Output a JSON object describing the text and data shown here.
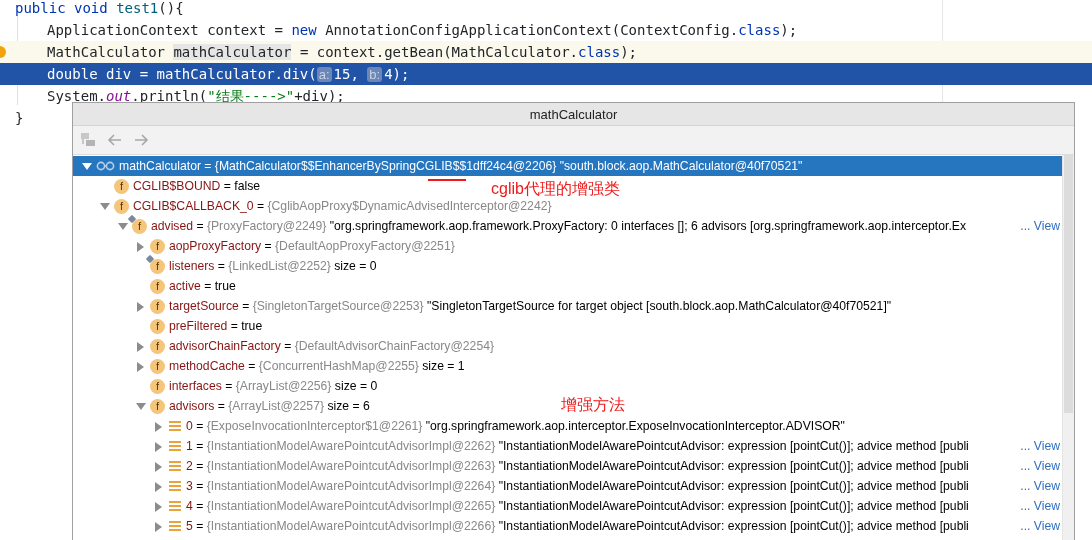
{
  "editor": {
    "lines": [
      {
        "caret": false,
        "current": false,
        "indented": false,
        "bulb": false,
        "tokens": [
          {
            "kind": "keyword",
            "text": "public void "
          },
          {
            "kind": "method",
            "text": "test1"
          },
          {
            "kind": "plain",
            "text": "(){"
          }
        ]
      },
      {
        "caret": false,
        "current": false,
        "indented": true,
        "bulb": false,
        "tokens": [
          {
            "kind": "plain",
            "text": "ApplicationContext context = "
          },
          {
            "kind": "keyword",
            "text": "new"
          },
          {
            "kind": "plain",
            "text": " AnnotationConfigApplicationContext(ContextConfig."
          },
          {
            "kind": "keyword",
            "text": "class"
          },
          {
            "kind": "plain",
            "text": ");"
          }
        ]
      },
      {
        "caret": true,
        "current": false,
        "indented": true,
        "bulb": true,
        "tokens": [
          {
            "kind": "plain",
            "text": "MathCalculator "
          },
          {
            "kind": "usage",
            "text": "mathCalculator"
          },
          {
            "kind": "plain",
            "text": " = context.getBean(MathCalculator."
          },
          {
            "kind": "keyword",
            "text": "class"
          },
          {
            "kind": "plain",
            "text": ");"
          }
        ]
      },
      {
        "caret": false,
        "current": true,
        "indented": true,
        "bulb": false,
        "tokens": [
          {
            "kind": "plain",
            "text": "double div = mathCalculator.div("
          },
          {
            "kind": "hint",
            "text": "a:"
          },
          {
            "kind": "plain",
            "text": "15, "
          },
          {
            "kind": "hint",
            "text": "b:"
          },
          {
            "kind": "plain",
            "text": "4);"
          }
        ]
      },
      {
        "caret": false,
        "current": false,
        "indented": true,
        "bulb": false,
        "tokens": [
          {
            "kind": "plain",
            "text": "System."
          },
          {
            "kind": "static",
            "text": "out"
          },
          {
            "kind": "plain",
            "text": ".println("
          },
          {
            "kind": "string",
            "text": "\"结果---->\""
          },
          {
            "kind": "plain",
            "text": "+div);"
          }
        ]
      },
      {
        "caret": false,
        "current": false,
        "indented": false,
        "bulb": false,
        "tokens": [
          {
            "kind": "plain",
            "text": "}"
          }
        ]
      }
    ]
  },
  "popup": {
    "title": "mathCalculator",
    "toolbar": [
      {
        "kind": "tree"
      },
      {
        "kind": "back"
      },
      {
        "kind": "forward"
      }
    ],
    "tree": [
      {
        "kind": "watch",
        "name": "mathCalculator",
        "eq": "=",
        "type": "{MathCalculator$$EnhancerBySpringCGLIB$$1dff24c4@2206}",
        "value": "\"south.block.aop.MathCalculator@40f70521\"",
        "selected": true,
        "expanded": true,
        "children": [
          {
            "kind": "field",
            "icon_letter": "f",
            "name": "CGLIB$BOUND",
            "eq": "=",
            "value": "false",
            "selected": false
          },
          {
            "kind": "field",
            "icon_letter": "f",
            "name": "CGLIB$CALLBACK_0",
            "eq": "=",
            "type": "{CglibAopProxy$DynamicAdvisedInterceptor@2242}",
            "selected": false,
            "expanded": true,
            "children": [
              {
                "kind": "tagged",
                "icon_letter": "f",
                "name": "advised",
                "eq": "=",
                "type": "{ProxyFactory@2249}",
                "value": "\"org.springframework.aop.framework.ProxyFactory: 0 interfaces []; 6 advisors [org.springframework.aop.interceptor.Ex",
                "link": "... View",
                "selected": false,
                "expanded": true,
                "children": [
                  {
                    "kind": "field",
                    "icon_letter": "f",
                    "name": "aopProxyFactory",
                    "eq": "=",
                    "type": "{DefaultAopProxyFactory@2251}",
                    "selected": false,
                    "expanded": false
                  },
                  {
                    "kind": "tagged",
                    "icon_letter": "f",
                    "name": "listeners",
                    "eq": "=",
                    "type": "{LinkedList@2252}",
                    "value": "size = 0",
                    "selected": false
                  },
                  {
                    "kind": "field",
                    "icon_letter": "f",
                    "name": "active",
                    "eq": "=",
                    "value": "true",
                    "selected": false
                  },
                  {
                    "kind": "field",
                    "icon_letter": "f",
                    "name": "targetSource",
                    "eq": "=",
                    "type": "{SingletonTargetSource@2253}",
                    "value": "\"SingletonTargetSource for target object [south.block.aop.MathCalculator@40f70521]\"",
                    "selected": false,
                    "expanded": false
                  },
                  {
                    "kind": "field",
                    "icon_letter": "f",
                    "name": "preFiltered",
                    "eq": "=",
                    "value": "true",
                    "selected": false
                  },
                  {
                    "kind": "field",
                    "icon_letter": "f",
                    "name": "advisorChainFactory",
                    "eq": "=",
                    "type": "{DefaultAdvisorChainFactory@2254}",
                    "selected": false,
                    "expanded": false
                  },
                  {
                    "kind": "field",
                    "icon_letter": "f",
                    "name": "methodCache",
                    "eq": "=",
                    "type": "{ConcurrentHashMap@2255}",
                    "value": "size = 1",
                    "selected": false,
                    "expanded": false
                  },
                  {
                    "kind": "field",
                    "icon_letter": "f",
                    "name": "interfaces",
                    "eq": "=",
                    "type": "{ArrayList@2256}",
                    "value": "size = 0",
                    "selected": false
                  },
                  {
                    "kind": "field",
                    "icon_letter": "f",
                    "name": "advisors",
                    "eq": "=",
                    "type": "{ArrayList@2257}",
                    "value": "size = 6",
                    "selected": false,
                    "expanded": true,
                    "children": [
                      {
                        "kind": "element",
                        "name": "0",
                        "eq": "=",
                        "type": "{ExposeInvocationInterceptor$1@2261}",
                        "value": "\"org.springframework.aop.interceptor.ExposeInvocationInterceptor.ADVISOR\"",
                        "selected": false,
                        "expanded": false
                      },
                      {
                        "kind": "element",
                        "name": "1",
                        "eq": "=",
                        "type": "{InstantiationModelAwarePointcutAdvisorImpl@2262}",
                        "value": "\"InstantiationModelAwarePointcutAdvisor: expression [pointCut()]; advice method [publi",
                        "link": "... View",
                        "selected": false,
                        "expanded": false
                      },
                      {
                        "kind": "element",
                        "name": "2",
                        "eq": "=",
                        "type": "{InstantiationModelAwarePointcutAdvisorImpl@2263}",
                        "value": "\"InstantiationModelAwarePointcutAdvisor: expression [pointCut()]; advice method [publi",
                        "link": "... View",
                        "selected": false,
                        "expanded": false
                      },
                      {
                        "kind": "element",
                        "name": "3",
                        "eq": "=",
                        "type": "{InstantiationModelAwarePointcutAdvisorImpl@2264}",
                        "value": "\"InstantiationModelAwarePointcutAdvisor: expression [pointCut()]; advice method [publi",
                        "link": "... View",
                        "selected": false,
                        "expanded": false
                      },
                      {
                        "kind": "element",
                        "name": "4",
                        "eq": "=",
                        "type": "{InstantiationModelAwarePointcutAdvisorImpl@2265}",
                        "value": "\"InstantiationModelAwarePointcutAdvisor: expression [pointCut()]; advice method [publi",
                        "link": "... View",
                        "selected": false,
                        "expanded": false
                      },
                      {
                        "kind": "element",
                        "name": "5",
                        "eq": "=",
                        "type": "{InstantiationModelAwarePointcutAdvisorImpl@2266}",
                        "value": "\"InstantiationModelAwarePointcutAdvisor: expression [pointCut()]; advice method [publi",
                        "link": "... View",
                        "selected": false,
                        "expanded": false
                      }
                    ]
                  }
                ]
              }
            ]
          }
        ]
      }
    ]
  },
  "annotations": [
    {
      "kind": "underline-note",
      "text": "cglib代理的增强类"
    },
    {
      "kind": "note",
      "text": "增强方法"
    }
  ]
}
